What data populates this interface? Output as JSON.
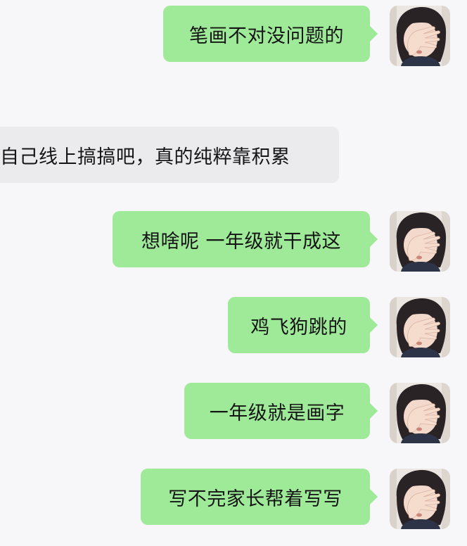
{
  "chat": {
    "messages": [
      {
        "id": "m1",
        "side": "out",
        "text": "笔画不对没问题的",
        "avatar_icon": "child-face-palm-avatar"
      },
      {
        "id": "m2",
        "side": "in",
        "text": "自己线上搞搞吧，真的纯粹靠积累"
      },
      {
        "id": "m3",
        "side": "out",
        "text": "想啥呢 一年级就干成这",
        "avatar_icon": "child-face-palm-avatar"
      },
      {
        "id": "m4",
        "side": "out",
        "text": "鸡飞狗跳的",
        "avatar_icon": "child-face-palm-avatar"
      },
      {
        "id": "m5",
        "side": "out",
        "text": "一年级就是画字",
        "avatar_icon": "child-face-palm-avatar"
      },
      {
        "id": "m6",
        "side": "out",
        "text": "写不完家长帮着写写",
        "avatar_icon": "child-face-palm-avatar"
      }
    ],
    "colors": {
      "background": "#f7f7f9",
      "outgoing_bubble": "#9eea98",
      "incoming_bubble": "#ebebee",
      "text": "#151515"
    }
  }
}
